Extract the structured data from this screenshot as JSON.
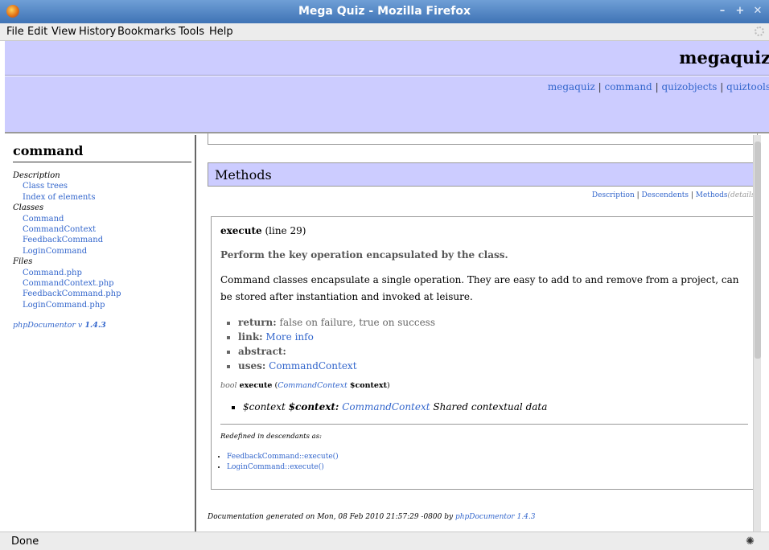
{
  "window": {
    "title": "Mega Quiz - Mozilla Firefox"
  },
  "menu": [
    "File",
    "Edit",
    "View",
    "History",
    "Bookmarks",
    "Tools",
    "Help"
  ],
  "banner": {
    "site": "megaquiz",
    "packages": [
      "megaquiz",
      "command",
      "quizobjects",
      "quiztools"
    ],
    "sep": "|"
  },
  "left": {
    "heading": "command",
    "description_label": "Description",
    "description_links": [
      "Class trees",
      "Index of elements"
    ],
    "classes_label": "Classes",
    "classes": [
      "Command",
      "CommandContext",
      "FeedbackCommand",
      "LoginCommand"
    ],
    "files_label": "Files",
    "files": [
      "Command.php",
      "CommandContext.php",
      "FeedbackCommand.php",
      "LoginCommand.php"
    ],
    "version_text": "phpDocumentor v",
    "version": "1.4.3"
  },
  "methods": {
    "heading": "Methods",
    "nav": {
      "description": "Description",
      "descendents": "Descendents",
      "methods": "Methods",
      "details": "details"
    }
  },
  "method": {
    "name": "execute",
    "line": "(line 29)",
    "short_desc": "Perform the key operation encapsulated by the class.",
    "long_desc": "Command classes encapsulate a single operation. They are easy to add to and remove from a project, can be stored after instantiation and invoked at leisure.",
    "tags": [
      {
        "label": "return:",
        "text": "false on failure, true on success",
        "link": false
      },
      {
        "label": "link:",
        "text": "More info",
        "link": true
      },
      {
        "label": "abstract:",
        "text": "",
        "link": false
      },
      {
        "label": "uses:",
        "text": "CommandContext",
        "link": true
      }
    ],
    "signature": {
      "type": "bool",
      "name": "execute",
      "param_type": "CommandContext",
      "param_name": "$context"
    },
    "param": {
      "var": "$context",
      "name": "$context:",
      "type": "CommandContext",
      "desc": "Shared contextual data"
    },
    "redefined_label": "Redefined in descendants as:",
    "redefined": [
      "FeedbackCommand::execute()",
      "LoginCommand::execute()"
    ]
  },
  "footer": {
    "text": "Documentation generated on Mon, 08 Feb 2010 21:57:29 -0800 by",
    "link": "phpDocumentor 1.4.3"
  },
  "status": {
    "text": "Done"
  }
}
